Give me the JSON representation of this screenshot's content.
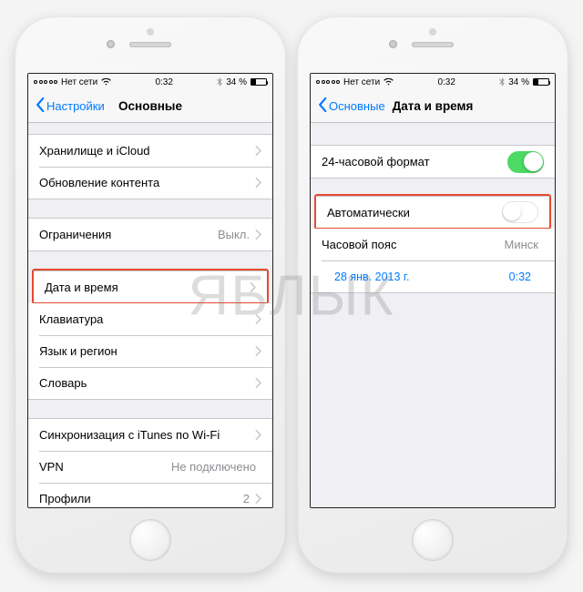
{
  "statusbar": {
    "carrier": "Нет сети",
    "time": "0:32",
    "battery": "34 %"
  },
  "left": {
    "back": "Настройки",
    "title": "Основные",
    "group1": [
      {
        "label": "Хранилище и iCloud"
      },
      {
        "label": "Обновление контента"
      }
    ],
    "group2": [
      {
        "label": "Ограничения",
        "value": "Выкл."
      }
    ],
    "group3": [
      {
        "label": "Дата и время",
        "highlight": true
      },
      {
        "label": "Клавиатура"
      },
      {
        "label": "Язык и регион"
      },
      {
        "label": "Словарь"
      }
    ],
    "group4": [
      {
        "label": "Синхронизация с iTunes по Wi-Fi"
      },
      {
        "label": "VPN",
        "value": "Не подключено"
      },
      {
        "label": "Профили",
        "value": "2"
      }
    ]
  },
  "right": {
    "back": "Основные",
    "title": "Дата и время",
    "row24h": "24-часовой формат",
    "rowAuto": "Автоматически",
    "rowTz": {
      "label": "Часовой пояс",
      "value": "Минск"
    },
    "rowDate": {
      "date": "28 янв. 2013 г.",
      "time": "0:32"
    }
  },
  "watermark": "ЯБЛЫК"
}
